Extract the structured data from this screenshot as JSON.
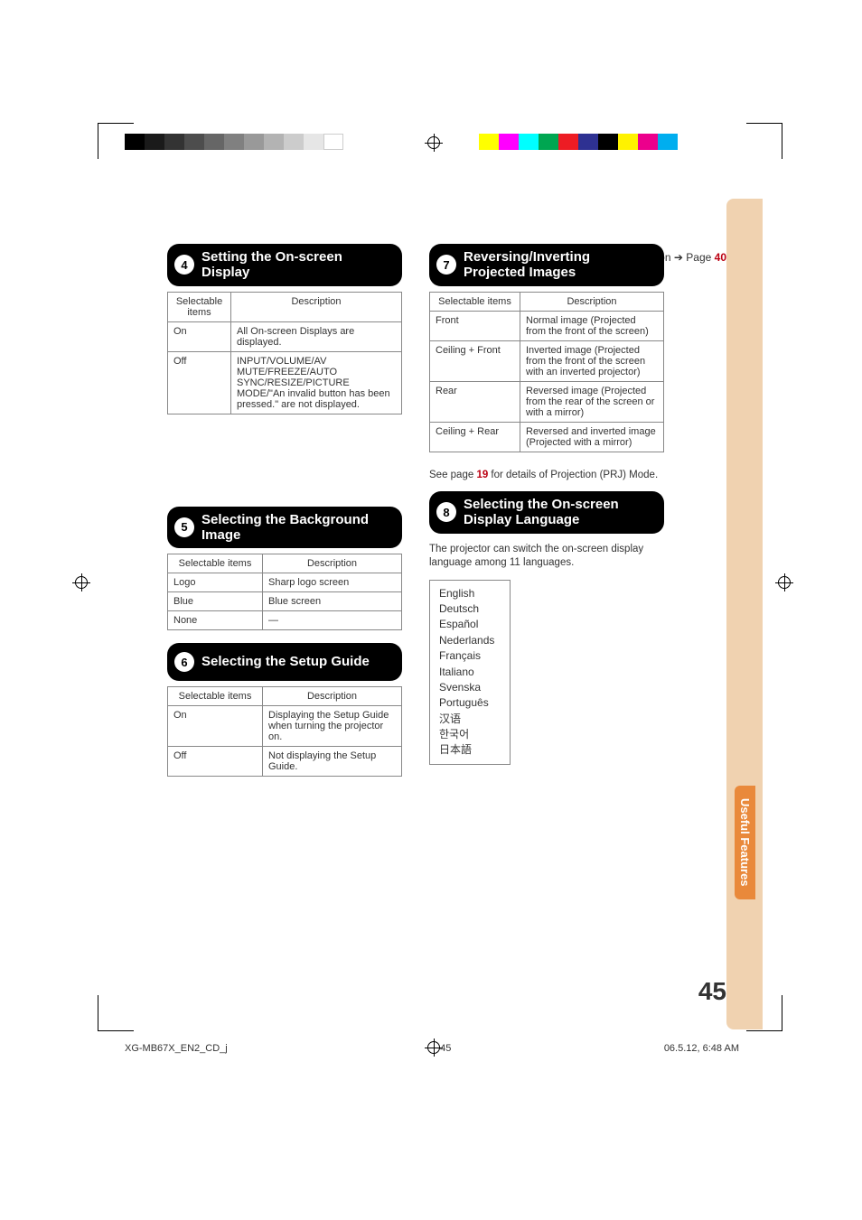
{
  "menu_operation": {
    "label": "Menu operation",
    "arrow": "➔",
    "page_label": "Page",
    "page": "40"
  },
  "sections": {
    "s4": {
      "num": "4",
      "title": "Setting the On-screen Display",
      "headers": [
        "Selectable items",
        "Description"
      ],
      "rows": [
        {
          "item": "On",
          "desc": "All On-screen Displays are displayed."
        },
        {
          "item": "Off",
          "desc": "INPUT/VOLUME/AV MUTE/FREEZE/AUTO SYNC/RESIZE/PICTURE MODE/\"An invalid button has been pressed.\" are not displayed."
        }
      ]
    },
    "s5": {
      "num": "5",
      "title": "Selecting the Background Image",
      "headers": [
        "Selectable items",
        "Description"
      ],
      "rows": [
        {
          "item": "Logo",
          "desc": "Sharp logo screen"
        },
        {
          "item": "Blue",
          "desc": "Blue screen"
        },
        {
          "item": "None",
          "desc": "—"
        }
      ]
    },
    "s6": {
      "num": "6",
      "title": "Selecting the Setup Guide",
      "headers": [
        "Selectable items",
        "Description"
      ],
      "rows": [
        {
          "item": "On",
          "desc": "Displaying the Setup Guide when turning the projector on."
        },
        {
          "item": "Off",
          "desc": "Not displaying the Setup Guide."
        }
      ]
    },
    "s7": {
      "num": "7",
      "title": "Reversing/Inverting Projected Images",
      "headers": [
        "Selectable items",
        "Description"
      ],
      "rows": [
        {
          "item": "Front",
          "desc": "Normal image (Projected from the front of the screen)"
        },
        {
          "item": "Ceiling + Front",
          "desc": "Inverted image (Projected from the front of the screen with an inverted projector)"
        },
        {
          "item": "Rear",
          "desc": "Reversed image (Projected from the rear of the screen or with a mirror)"
        },
        {
          "item": "Ceiling + Rear",
          "desc": "Reversed and inverted image (Projected with a mirror)"
        }
      ],
      "note_pre": "See page ",
      "note_page": "19",
      "note_post": " for details of Projection (PRJ) Mode."
    },
    "s8": {
      "num": "8",
      "title": "Selecting the On-screen Display Language",
      "intro": "The projector can switch the on-screen display language among 11 languages.",
      "languages": [
        "English",
        "Deutsch",
        "Español",
        "Nederlands",
        "Français",
        "Italiano",
        "Svenska",
        "Português",
        "汉语",
        "한국어",
        "日本語"
      ]
    }
  },
  "side_tab": "Useful Features",
  "page_number": "45",
  "footer": {
    "doc": "XG-MB67X_EN2_CD_j",
    "pg": "45",
    "ts": "06.5.12, 6:48 AM"
  }
}
